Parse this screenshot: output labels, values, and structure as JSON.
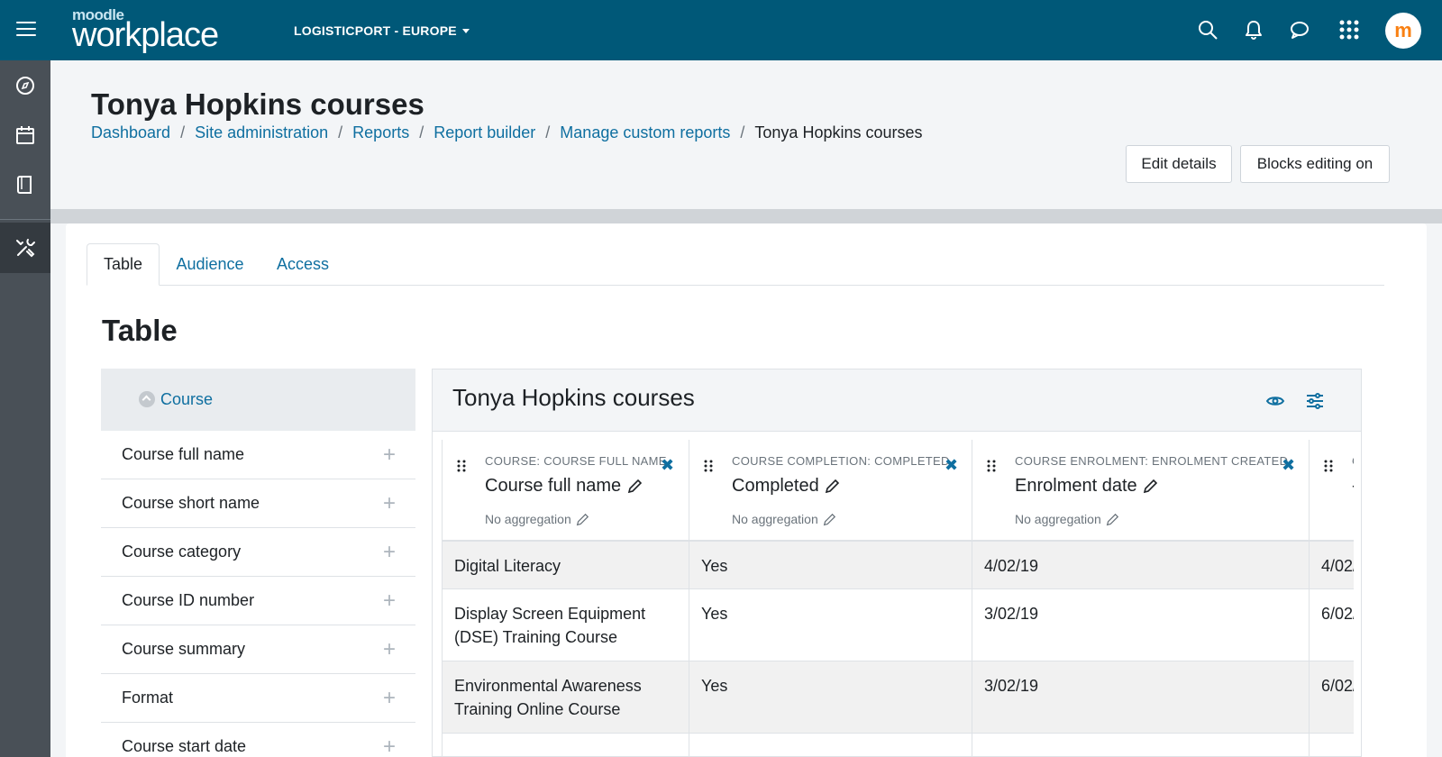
{
  "navbar": {
    "logo_small": "moodle",
    "logo_big": "workplace",
    "tenant": "LOGISTICPORT - EUROPE",
    "avatar_letter": "m",
    "icons": [
      "menu-icon",
      "search-icon",
      "bell-icon",
      "chat-icon",
      "apps-grid-icon"
    ],
    "bg_color": "#005878"
  },
  "drawer": {
    "items": [
      "compass-icon",
      "calendar-icon",
      "book-icon",
      "tools-icon"
    ]
  },
  "header": {
    "title": "Tonya Hopkins courses",
    "breadcrumb": [
      "Dashboard",
      "Site administration",
      "Reports",
      "Report builder",
      "Manage custom reports"
    ],
    "breadcrumb_current": "Tonya Hopkins courses",
    "edit_details": "Edit details",
    "blocks_editing": "Blocks editing on"
  },
  "tabs": [
    "Table",
    "Audience",
    "Access"
  ],
  "section_title": "Table",
  "sidebar": {
    "group": "Course",
    "items": [
      "Course full name",
      "Course short name",
      "Course category",
      "Course ID number",
      "Course summary",
      "Format",
      "Course start date"
    ]
  },
  "report": {
    "title": "Tonya Hopkins courses",
    "aggregation_label": "No aggregation",
    "columns": [
      {
        "key": "COURSE: COURSE FULL NAME",
        "name": "Course full name"
      },
      {
        "key": "COURSE COMPLETION: COMPLETED",
        "name": "Completed"
      },
      {
        "key": "COURSE ENROLMENT: ENROLMENT CREATED",
        "name": "Enrolment date"
      },
      {
        "key": "C",
        "name": "-"
      }
    ],
    "rows": [
      [
        "Digital Literacy",
        "Yes",
        "4/02/19",
        "4/02/"
      ],
      [
        "Display Screen Equipment (DSE) Training Course",
        "Yes",
        "3/02/19",
        "6/02/"
      ],
      [
        "Environmental Awareness Training Online Course",
        "Yes",
        "3/02/19",
        "6/02/"
      ]
    ]
  },
  "colors": {
    "link": "#0f6fa0",
    "navbar": "#005878",
    "drawer": "#495057"
  }
}
